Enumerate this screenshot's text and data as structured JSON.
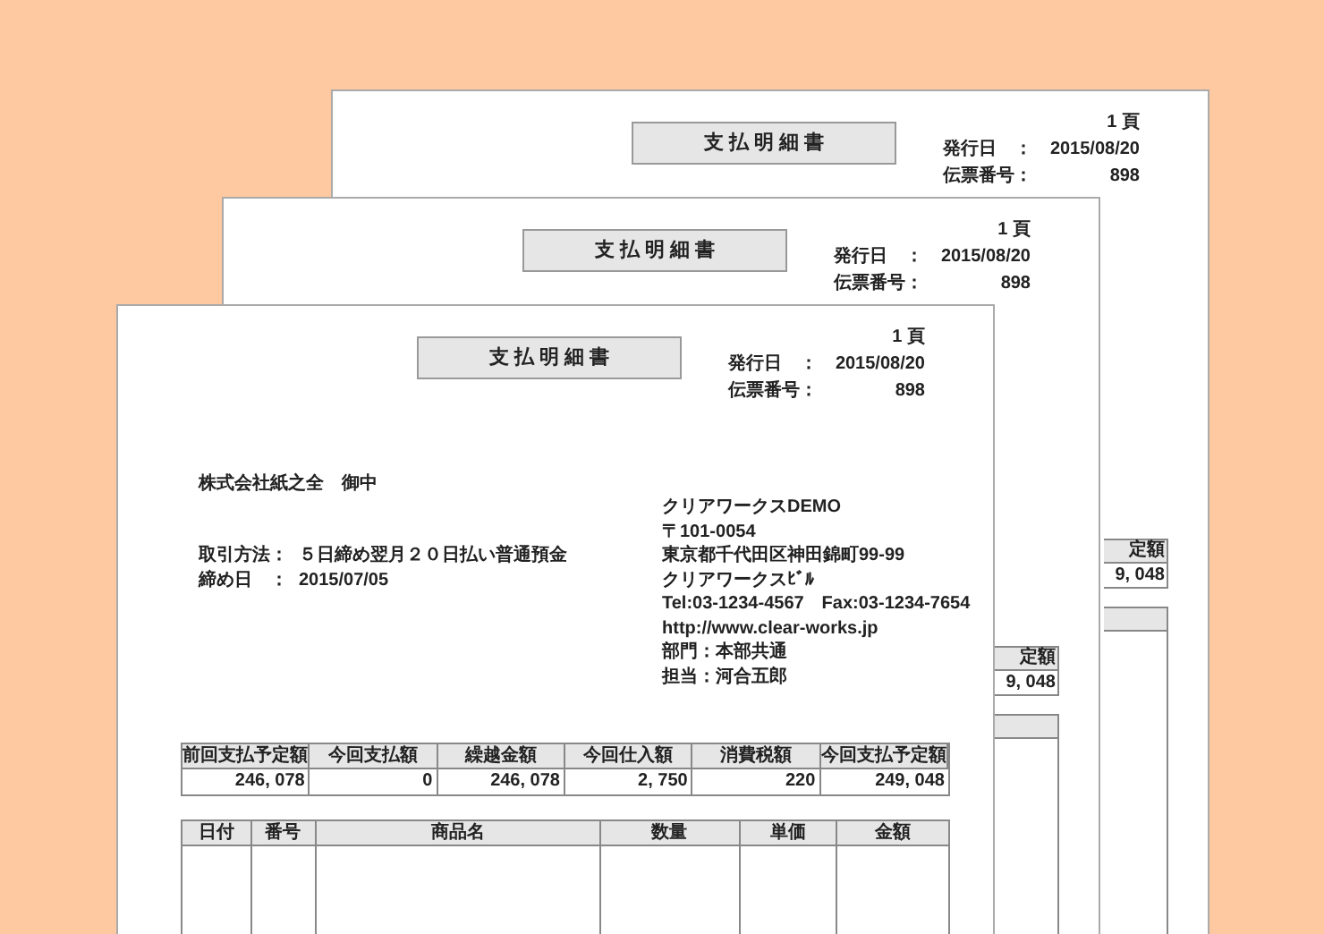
{
  "back_pages": [
    {
      "title": "支 払 明 細 書",
      "page_no": "1 頁",
      "issue_date_label": "発行日　：",
      "issue_date": "2015/08/20",
      "slip_label": "伝票番号：",
      "slip_no": "898",
      "fragment": {
        "header": "定額",
        "value": "9, 048"
      }
    },
    {
      "title": "支 払 明 細 書",
      "page_no": "1 頁",
      "issue_date_label": "発行日　：",
      "issue_date": "2015/08/20",
      "slip_label": "伝票番号：",
      "slip_no": "898",
      "fragment": {
        "header": "定額",
        "value": "9, 048"
      }
    }
  ],
  "front_page": {
    "title": "支 払 明 細 書",
    "page_no": "1 頁",
    "issue_date_label": "発行日　：",
    "issue_date": "2015/08/20",
    "slip_label": "伝票番号：",
    "slip_no": "898",
    "recipient": "株式会社紙之全　御中",
    "terms_label": "取引方法：",
    "terms": "５日締め翌月２０日払い普通預金",
    "closing_label": "締め日　：",
    "closing_date": "2015/07/05",
    "sender_lines": [
      "クリアワークスDEMO",
      "〒101-0054",
      "東京都千代田区神田錦町99-99",
      "クリアワークスﾋﾞﾙ",
      "Tel:03-1234-4567　Fax:03-1234-7654",
      "http://www.clear-works.jp",
      "部門：本部共通",
      "担当：河合五郎"
    ],
    "summary": {
      "columns": [
        "前回支払予定額",
        "今回支払額",
        "繰越金額",
        "今回仕入額",
        "消費税額",
        "今回支払予定額"
      ],
      "values": [
        "246, 078",
        "0",
        "246, 078",
        "2, 750",
        "220",
        "249, 048"
      ]
    },
    "items": {
      "columns": [
        "日付",
        "番号",
        "商品名",
        "数量",
        "単価",
        "金額"
      ]
    }
  }
}
